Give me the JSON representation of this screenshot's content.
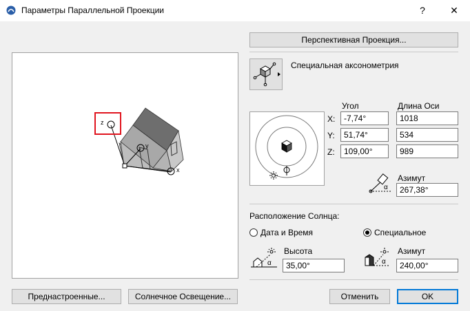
{
  "window": {
    "title": "Параметры Параллельной Проекции",
    "help_label": "?",
    "close_label": "✕"
  },
  "projection": {
    "perspective_button": "Перспективная Проекция...",
    "mode_label": "Специальная аксонометрия",
    "preview_axis_z": "z",
    "preview_axis_y": "y",
    "preview_axis_x": "x"
  },
  "angles": {
    "angle_header": "Угол",
    "length_header": "Длина Оси",
    "rows": [
      {
        "axis": "X:",
        "angle": "-7,74°",
        "length": "1018"
      },
      {
        "axis": "Y:",
        "angle": "51,74°",
        "length": "534"
      },
      {
        "axis": "Z:",
        "angle": "109,00°",
        "length": "989"
      }
    ],
    "azimuth_label": "Азимут",
    "azimuth_value": "267,38°"
  },
  "sun": {
    "section_label": "Расположение Солнца:",
    "option_date": "Дата и Время",
    "option_special": "Специальное",
    "selected": "special",
    "height_label": "Высота",
    "height_value": "35,00°",
    "azimuth_label": "Азимут",
    "azimuth_value": "240,00°",
    "alpha": "α"
  },
  "footer": {
    "presets_button": "Преднастроенные...",
    "sun_button": "Солнечное Освещение...",
    "cancel_button": "Отменить",
    "ok_button": "OK"
  },
  "colors": {
    "accent": "#0078d7",
    "highlight_box": "#e0141e"
  }
}
